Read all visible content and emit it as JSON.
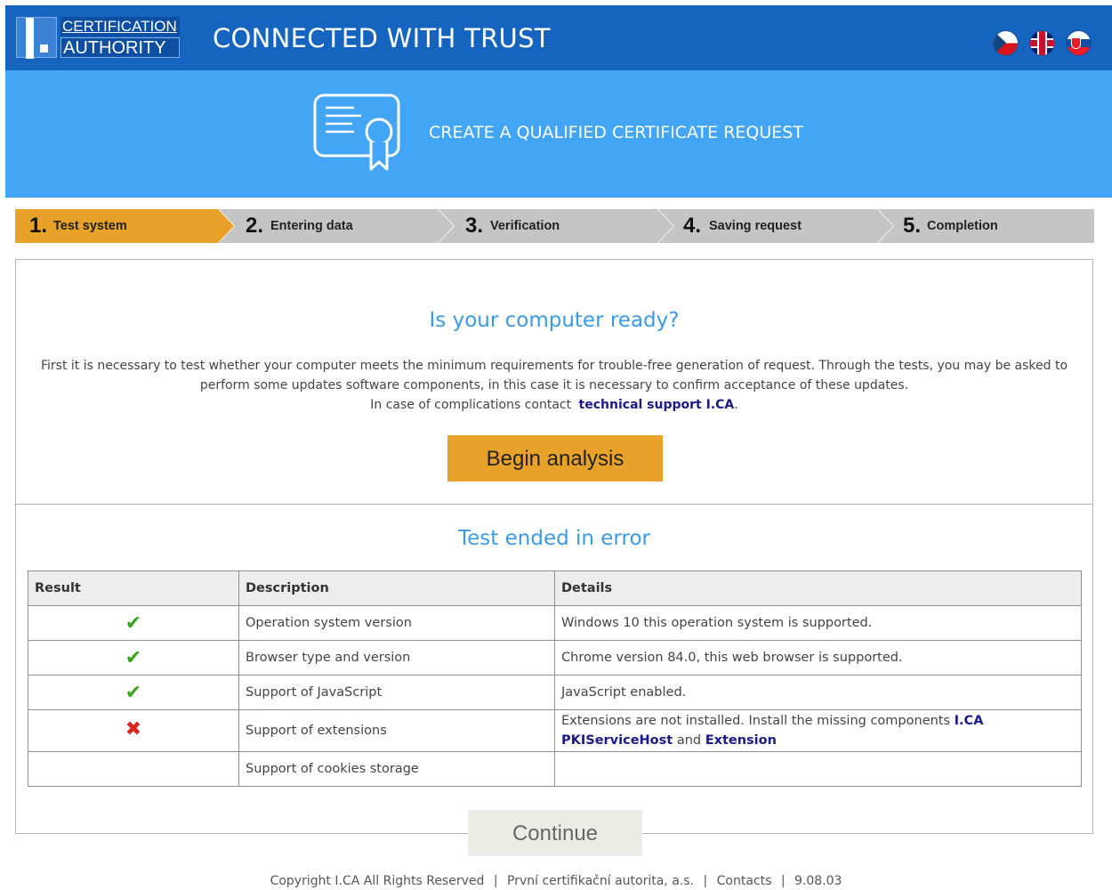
{
  "header": {
    "logo_line1": "CERTIFICATION",
    "logo_line2": "AUTHORITY",
    "tagline": "CONNECTED WITH TRUST",
    "languages": [
      "cz-flag-icon",
      "uk-flag-icon",
      "sk-flag-icon"
    ]
  },
  "banner": {
    "icon": "certificate-icon",
    "title": "CREATE A QUALIFIED CERTIFICATE REQUEST"
  },
  "steps": [
    {
      "num": "1.",
      "label": "Test system",
      "active": true
    },
    {
      "num": "2.",
      "label": "Entering data",
      "active": false
    },
    {
      "num": "3.",
      "label": "Verification",
      "active": false
    },
    {
      "num": "4.",
      "label": "Saving request",
      "active": false
    },
    {
      "num": "5.",
      "label": "Completion",
      "active": false
    }
  ],
  "main": {
    "heading": "Is your computer ready?",
    "intro_line1": "First it is necessary to test whether your computer meets the minimum requirements for trouble-free generation of request. Through the tests, you may be asked to perform some updates software components, in this case it is necessary to confirm acceptance of these updates.",
    "intro_line2_prefix": "In case of complications contact",
    "intro_link": "technical support I.CA",
    "intro_line2_suffix": ".",
    "begin_button": "Begin analysis",
    "result_heading": "Test ended in error",
    "table": {
      "headers": [
        "Result",
        "Description",
        "Details"
      ],
      "rows": [
        {
          "result": "✔",
          "description": "Operation system version",
          "details": "Windows 10 this operation system is supported."
        },
        {
          "result": "✔",
          "description": "Browser type and version",
          "details": "Chrome version 84.0, this web browser is supported."
        },
        {
          "result": "✔",
          "description": "Support of JavaScript",
          "details": "JavaScript enabled."
        },
        {
          "result": "✖",
          "description": "Support of extensions",
          "details_prefix": "Extensions are not installed. Install the missing components",
          "details_link1": "I.CA PKIServiceHost",
          "details_mid": "and",
          "details_link2": "Extension"
        },
        {
          "result": "",
          "description": "Support of cookies storage",
          "details": ""
        }
      ]
    },
    "continue_button": "Continue"
  },
  "colors": {
    "header_bg": "#1565c0",
    "banner_bg": "#42a5f5",
    "accent_orange": "#e8a22a",
    "heading_blue": "#3a9ae8",
    "ok_green": "#3aa31e",
    "error_red": "#d9261c"
  },
  "footer": {
    "copyright": "Copyright I.CA All Rights Reserved",
    "company": "První certifikační autorita, a.s.",
    "contacts": "Contacts",
    "version": "9.08.03",
    "separator": "|"
  }
}
